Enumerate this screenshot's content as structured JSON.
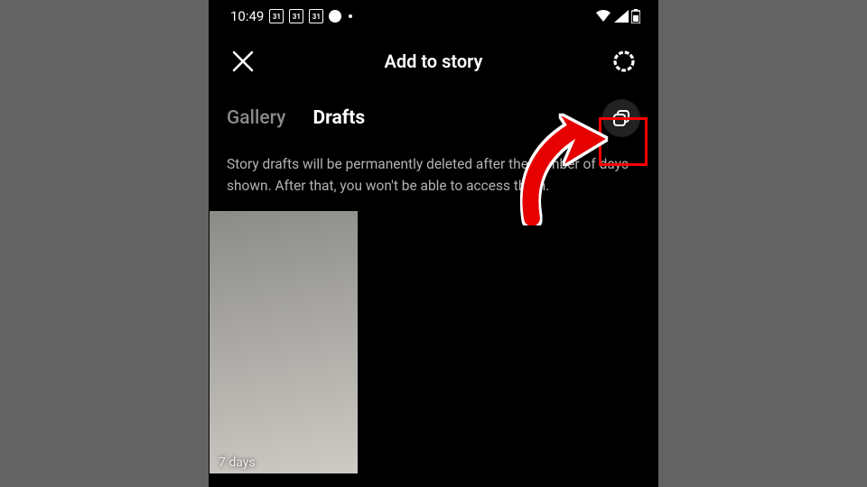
{
  "status": {
    "time": "10:49",
    "cal": "31",
    "wifi": "▾",
    "battery": "▮"
  },
  "header": {
    "title": "Add to story"
  },
  "tabs": {
    "gallery": "Gallery",
    "drafts": "Drafts"
  },
  "info": "Story drafts will be permanently deleted after the number of days shown. After that, you won't be able to access them.",
  "thumb": {
    "label": "7 days"
  }
}
